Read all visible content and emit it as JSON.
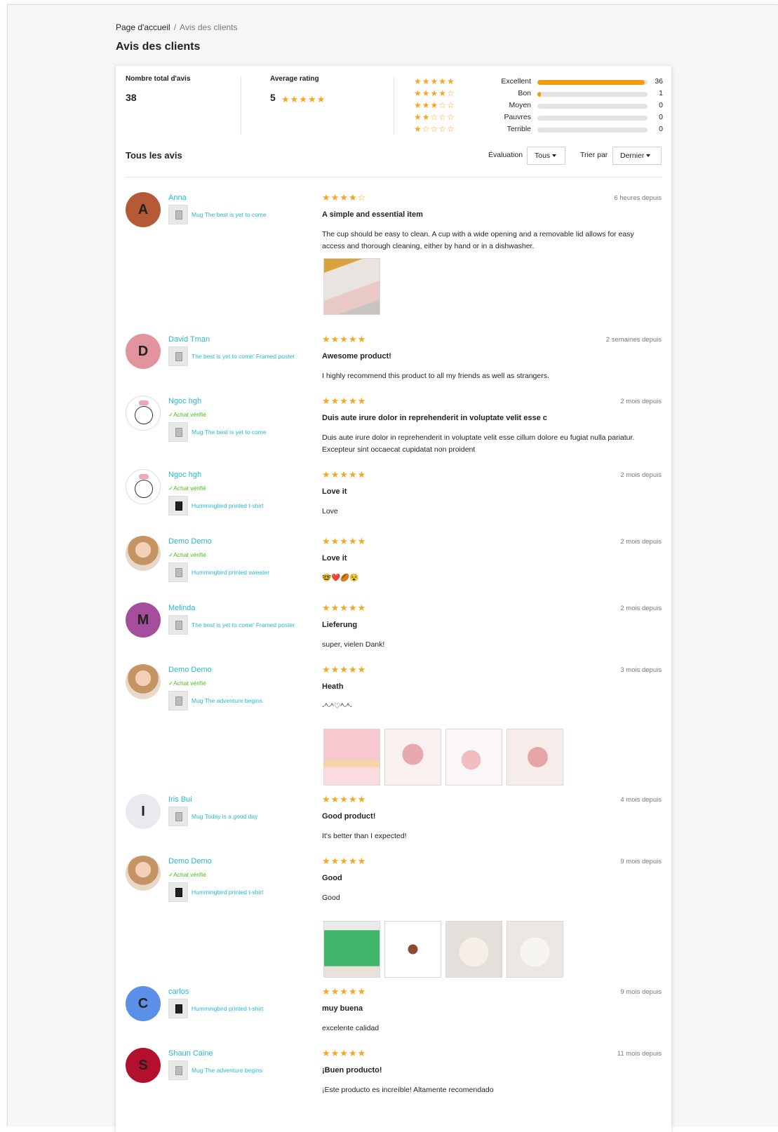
{
  "breadcrumb": {
    "home": "Page d'accueil",
    "separator": "/",
    "current": "Avis des clients"
  },
  "page_title": "Avis des clients",
  "summary": {
    "total_label": "Nombre total d'avis",
    "total_value": "38",
    "avg_label": "Average rating",
    "avg_value": "5",
    "avg_stars": "★★★★★",
    "distribution": [
      {
        "stars": "★★★★★",
        "label": "Excellent",
        "count": "36",
        "fraction": 0.973
      },
      {
        "stars": "★★★★☆",
        "label": "Bon",
        "count": "1",
        "fraction": 0.027
      },
      {
        "stars": "★★★☆☆",
        "label": "Moyen",
        "count": "0",
        "fraction": 0
      },
      {
        "stars": "★★☆☆☆",
        "label": "Pauvres",
        "count": "0",
        "fraction": 0
      },
      {
        "stars": "★☆☆☆☆",
        "label": "Terrible",
        "count": "0",
        "fraction": 0
      }
    ]
  },
  "list": {
    "title": "Tous les avis",
    "rating_filter_label": "Évaluation",
    "rating_filter_value": "Tous",
    "sort_label": "Trier par",
    "sort_value": "Dernier"
  },
  "colors": {
    "star": "#f5a623",
    "link": "#24b9d7",
    "verified": "#4cbb17",
    "bar": "#f39c12"
  },
  "reviews": [
    {
      "initial": "A",
      "avatar_color": "#b55a36",
      "author": "Anna",
      "verified": "",
      "product": "Mug The best is yet to come",
      "stars": "★★★★☆",
      "time": "6 heures depuis",
      "title": "A simple and essential item",
      "body": "The cup should be easy to clean. A cup with a wide opening and a removable lid allows for easy access and thorough cleaning, either by hand or in a dishwasher."
    },
    {
      "initial": "D",
      "avatar_color": "#e3939c",
      "author": "David Tman",
      "verified": "",
      "product": "The best is yet to come' Framed poster",
      "stars": "★★★★★",
      "time": "2 semaines depuis",
      "title": "Awesome product!",
      "body": "I highly recommend this product to all my friends as well as strangers."
    },
    {
      "initial": "",
      "avatar_color": "",
      "author": "Ngoc hgh",
      "verified": "✓Achat vérifié",
      "product": "Mug The best is yet to come",
      "stars": "★★★★★",
      "time": "2 mois depuis",
      "title": "Duis aute irure dolor in reprehenderit in voluptate velit esse c",
      "body": "Duis aute irure dolor in reprehenderit in voluptate velit esse cillum dolore eu fugiat nulla pariatur. Excepteur sint occaecat cupidatat non proident"
    },
    {
      "initial": "",
      "avatar_color": "",
      "author": "Ngoc hgh",
      "verified": "✓Achat vérifié",
      "product": "Hummingbird printed t-shirt",
      "stars": "★★★★★",
      "time": "2 mois depuis",
      "title": "Love it",
      "body": "Love"
    },
    {
      "initial": "",
      "avatar_color": "",
      "author": "Demo Demo",
      "verified": "✓Achat vérifié",
      "product": "Hummingbird printed sweater",
      "stars": "★★★★★",
      "time": "2 mois depuis",
      "title": "Love it",
      "body": "🤓❤️🏉😵"
    },
    {
      "initial": "M",
      "avatar_color": "#a64e9e",
      "author": "Melinda",
      "verified": "",
      "product": "The best is yet to come' Framed poster",
      "stars": "★★★★★",
      "time": "2 mois depuis",
      "title": "Lieferung",
      "body": "super, vielen Dank!"
    },
    {
      "initial": "",
      "avatar_color": "",
      "author": "Demo Demo",
      "verified": "✓Achat vérifié",
      "product": "Mug The adventure begins",
      "stars": "★★★★★",
      "time": "3 mois depuis",
      "title": "Heath",
      "body": "-^-^♡^-^-"
    },
    {
      "initial": "I",
      "avatar_color": "#ebe9f0",
      "author": "Iris Bui",
      "verified": "",
      "product": "Mug Today is a good day",
      "stars": "★★★★★",
      "time": "4 mois depuis",
      "title": "Good product!",
      "body": "It's better than I expected!"
    },
    {
      "initial": "",
      "avatar_color": "",
      "author": "Demo Demo",
      "verified": "✓Achat vérifié",
      "product": "Hummingbird printed t-shirt",
      "stars": "★★★★★",
      "time": "9 mois depuis",
      "title": "Good",
      "body": "Good"
    },
    {
      "initial": "C",
      "avatar_color": "#5b8fe8",
      "author": "carlos",
      "verified": "",
      "product": "Hummingbird printed t-shirt",
      "stars": "★★★★★",
      "time": "9 mois depuis",
      "title": "muy buena",
      "body": "excelente calidad"
    },
    {
      "initial": "S",
      "avatar_color": "#b3102e",
      "author": "Shaun Caine",
      "verified": "",
      "product": "Mug The adventure begins",
      "stars": "★★★★★",
      "time": "11 mois depuis",
      "title": "¡Buen producto!",
      "body": "¡Este producto es increíble! Altamente recomendado"
    }
  ]
}
